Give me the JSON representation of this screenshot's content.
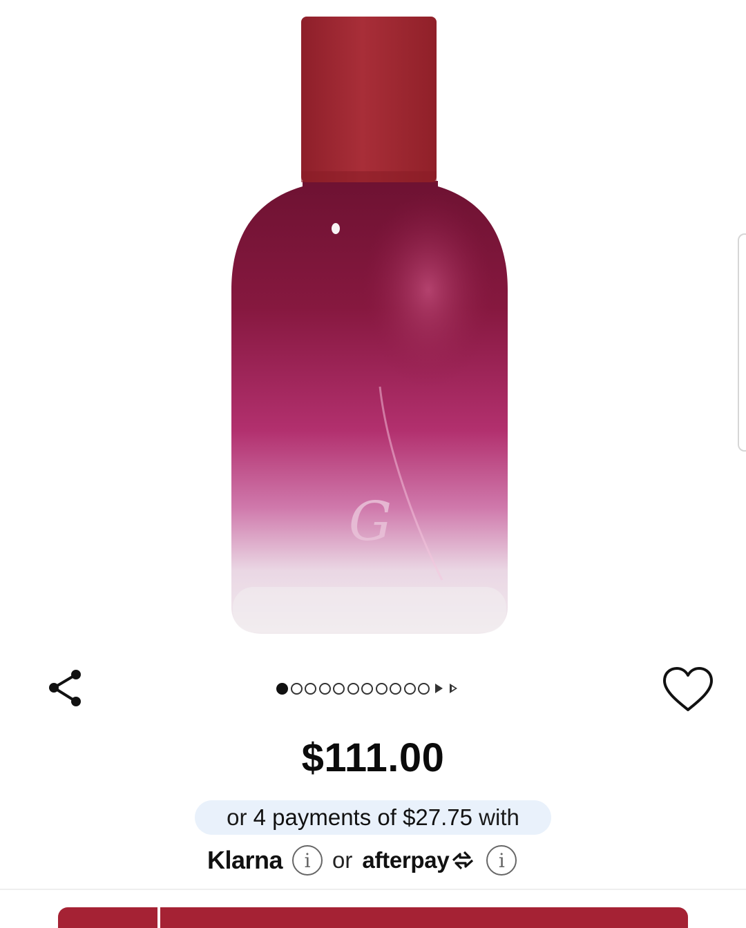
{
  "product": {
    "image_alt": "Perfume bottle with red cap and magenta gradient glass",
    "colors": {
      "cap": "#a02a34",
      "glass_top": "#7a1536",
      "glass_mid": "#b2306e",
      "glass_bottom": "#ece2ea"
    }
  },
  "actions": {
    "share_icon": "share-icon",
    "favorite_icon": "heart-icon"
  },
  "pager": {
    "total_dots": 11,
    "active_index": 0,
    "arrows": [
      "next",
      "last"
    ]
  },
  "price": {
    "amount": "$111.00"
  },
  "financing": {
    "klarna_prefix": "or ",
    "klarna_amount": "4 payments of $27.75",
    "klarna_suffix": " with",
    "klarna_logo": "Klarna",
    "or_label": "or",
    "afterpay_logo": "afterpay",
    "info_glyph": "i"
  },
  "cta": {
    "primary_color": "#a52234"
  }
}
